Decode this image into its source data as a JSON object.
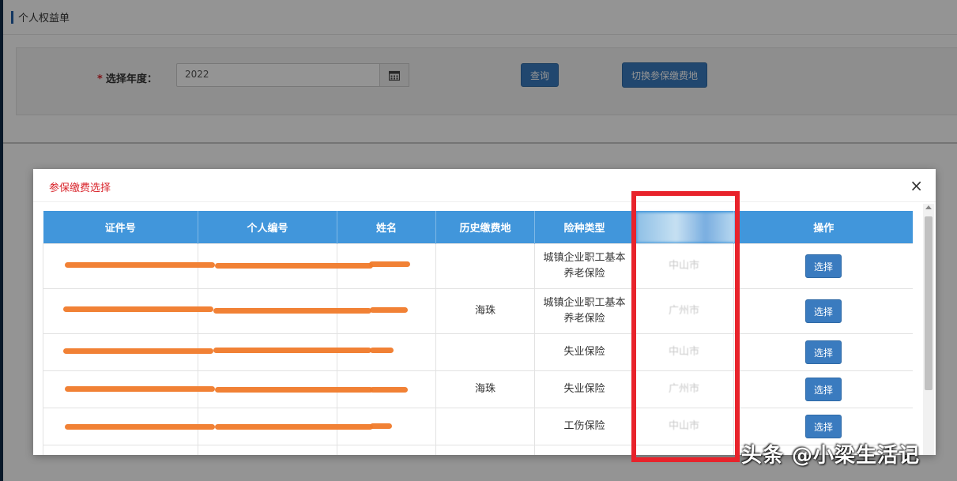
{
  "page": {
    "title": "个人权益单",
    "filter": {
      "year_label": "选择年度：",
      "required_mark": "*",
      "year_value": "2022",
      "query_label": "查询",
      "switch_label": "切换参保缴费地"
    }
  },
  "modal": {
    "title": "参保缴费选择",
    "close_glyph": "×",
    "columns": [
      "证件号",
      "个人编号",
      "姓名",
      "历史缴费地",
      "险种类型",
      "",
      "操作"
    ],
    "rows": [
      {
        "history_place": "",
        "insurance_type": "城镇企业职工基本养老保险",
        "city": "中山市",
        "action": "选择"
      },
      {
        "history_place": "海珠",
        "insurance_type": "城镇企业职工基本养老保险",
        "city": "广州市",
        "action": "选择"
      },
      {
        "history_place": "",
        "insurance_type": "失业保险",
        "city": "中山市",
        "action": "选择"
      },
      {
        "history_place": "海珠",
        "insurance_type": "失业保险",
        "city": "广州市",
        "action": "选择"
      },
      {
        "history_place": "",
        "insurance_type": "工伤保险",
        "city": "中山市",
        "action": "选择"
      }
    ]
  },
  "watermark": "头条 @小梁生活记",
  "colors": {
    "header_blue": "#4196db",
    "button_blue": "#3a7bbf",
    "title_red": "#d9242b",
    "annotation_red": "#e8232b",
    "redaction_orange": "#f07a2a"
  }
}
